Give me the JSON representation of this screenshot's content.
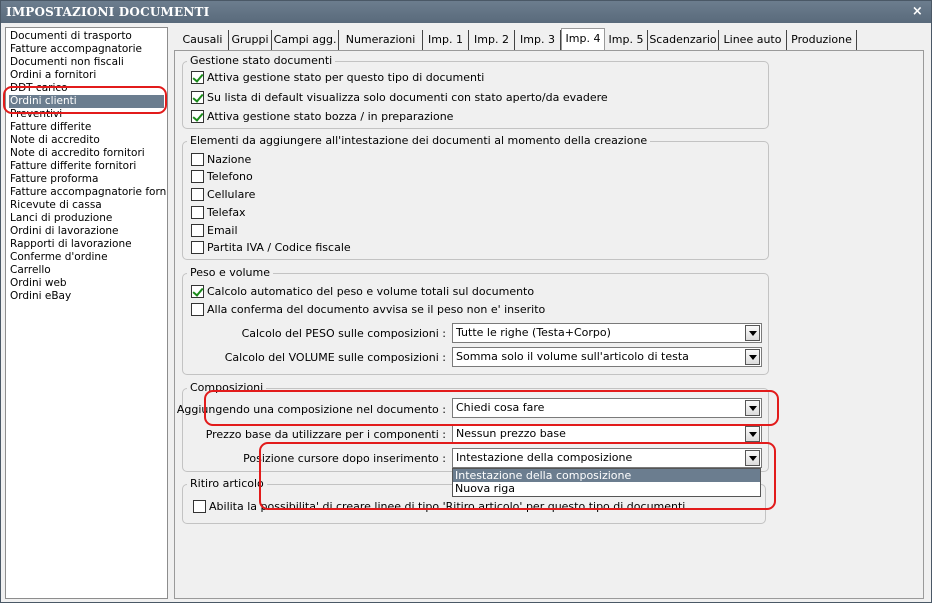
{
  "window": {
    "title": "IMPOSTAZIONI DOCUMENTI",
    "close_label": "×"
  },
  "doclist": {
    "items": [
      "Documenti di trasporto",
      "Fatture accompagnatorie",
      "Documenti non fiscali",
      "Ordini a fornitori",
      "DDT carico",
      "Ordini clienti",
      "Preventivi",
      "Fatture differite",
      "Note di accredito",
      "Note di accredito fornitori",
      "Fatture differite fornitori",
      "Fatture proforma",
      "Fatture accompagnatorie fornito",
      "Ricevute di cassa",
      "Lanci di produzione",
      "Ordini di lavorazione",
      "Rapporti di lavorazione",
      "Conferme d'ordine",
      "Carrello",
      "Ordini web",
      "Ordini eBay"
    ],
    "selected": "Ordini clienti"
  },
  "tabs": [
    "Causali",
    "Gruppi",
    "Campi agg.",
    "Numerazioni",
    "Imp. 1",
    "Imp. 2",
    "Imp. 3",
    "Imp. 4",
    "Imp. 5",
    "Scadenzario",
    "Linee auto",
    "Produzione"
  ],
  "active_tab": "Imp. 4",
  "gestione": {
    "label": "Gestione stato documenti",
    "checks": [
      {
        "label": "Attiva gestione stato per questo tipo di documenti",
        "checked": true
      },
      {
        "label": "Su lista di default visualizza solo documenti con stato aperto/da evadere",
        "checked": true
      },
      {
        "label": "Attiva gestione stato bozza / in preparazione",
        "checked": true
      }
    ]
  },
  "intestazione": {
    "label": "Elementi da aggiungere all'intestazione dei documenti al momento della creazione",
    "checks": [
      {
        "label": "Nazione",
        "checked": false
      },
      {
        "label": "Telefono",
        "checked": false
      },
      {
        "label": "Cellulare",
        "checked": false
      },
      {
        "label": "Telefax",
        "checked": false
      },
      {
        "label": "Email",
        "checked": false
      },
      {
        "label": "Partita IVA / Codice fiscale",
        "checked": false
      }
    ]
  },
  "peso": {
    "label": "Peso e volume",
    "checks": [
      {
        "label": "Calcolo automatico del peso e volume totali sul documento",
        "checked": true
      },
      {
        "label": "Alla conferma del documento avvisa se il peso non e' inserito",
        "checked": false
      }
    ],
    "peso_label": "Calcolo del PESO sulle composizioni :",
    "peso_value": "Tutte le righe (Testa+Corpo)",
    "volume_label": "Calcolo del VOLUME sulle composizioni :",
    "volume_value": "Somma solo il volume sull'articolo di testa"
  },
  "composizioni": {
    "label": "Composizioni",
    "aggiungendo_label": "Aggiungendo una composizione nel documento :",
    "aggiungendo_value": "Chiedi cosa fare",
    "prezzo_label": "Prezzo base da utilizzare per i componenti :",
    "prezzo_value": "Nessun prezzo base",
    "cursore_label": "Posizione cursore dopo inserimento :",
    "cursore_value": "Intestazione della composizione",
    "cursore_options": [
      "Intestazione della composizione",
      "Nuova riga"
    ]
  },
  "ritiro": {
    "label": "Ritiro articolo",
    "check": {
      "label": "Abilita la possibilita' di creare linee di tipo 'Ritiro articolo' per questo tipo di documenti",
      "checked": false
    }
  },
  "colors": {
    "titlebar": "#5f7081",
    "selection": "#6b7d8f",
    "annotation": "#e21b1b",
    "check": "#1a8a1a"
  }
}
